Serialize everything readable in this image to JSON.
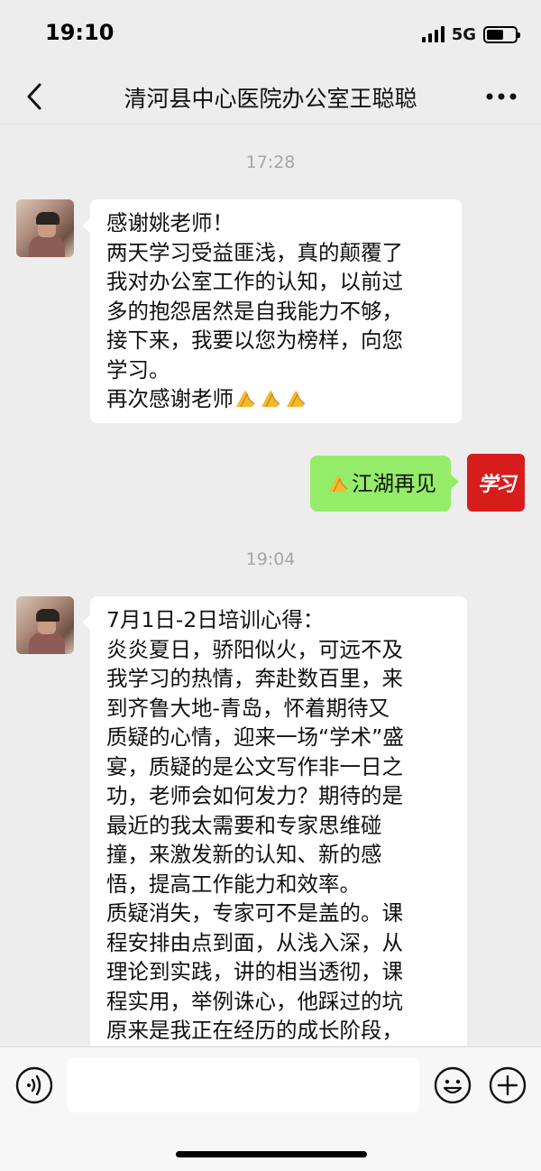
{
  "status_bar": {
    "time": "19:10",
    "network": "5G"
  },
  "header": {
    "title": "清河县中心医院办公室王聪聪"
  },
  "messages": [
    {
      "type": "time",
      "text": "17:28"
    },
    {
      "type": "incoming",
      "lines": [
        "感谢姚老师！",
        "两天学习受益匪浅，真的颠覆了",
        "我对办公室工作的认知，以前过",
        "多的抱怨居然是自我能力不够，",
        "接下来，我要以您为榜样，向您",
        "学习。",
        "再次感谢老师"
      ],
      "emoji_count": 3
    },
    {
      "type": "outgoing",
      "text": "江湖再见",
      "avatar_text": "学习"
    },
    {
      "type": "time",
      "text": "19:04"
    },
    {
      "type": "incoming",
      "lines": [
        "7月1日-2日培训心得：",
        "炎炎夏日，骄阳似火，可远不及",
        "我学习的热情，奔赴数百里，来",
        "到齐鲁大地-青岛，怀着期待又",
        "质疑的心情，迎来一场“学术”盛",
        "宴，质疑的是公文写作非一日之",
        "功，老师会如何发力？期待的是",
        "最近的我太需要和专家思维碰",
        "撞，来激发新的认知、新的感",
        "悟，提高工作能力和效率。",
        "质疑消失，专家可不是盖的。课",
        "程安排由点到面，从浅入深，从",
        "理论到实践，讲的相当透彻，课",
        "程实用，举例诛心，他踩过的坑",
        "原来是我正在经历的成长阶段，"
      ]
    }
  ],
  "colors": {
    "outgoing_bubble": "#95ec69",
    "incoming_bubble": "#ffffff",
    "background": "#ededed",
    "self_avatar": "#d81c1c"
  },
  "icons": [
    "back-icon",
    "more-icon",
    "clap-emoji",
    "voice-icon",
    "emoji-icon",
    "plus-icon"
  ]
}
